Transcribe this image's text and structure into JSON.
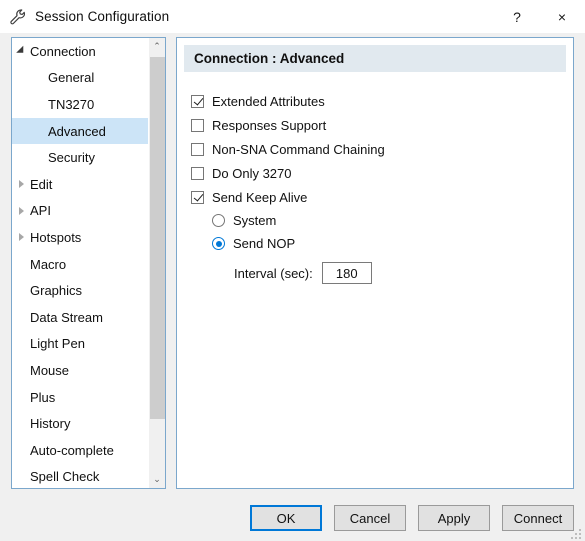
{
  "window": {
    "title": "Session Configuration",
    "icon": "wrench-icon",
    "help_label": "?",
    "close_label": "×"
  },
  "sidebar": {
    "items": [
      {
        "label": "Connection",
        "level": 0,
        "twisty": "expanded",
        "selected": false
      },
      {
        "label": "General",
        "level": 1,
        "twisty": "none",
        "selected": false
      },
      {
        "label": "TN3270",
        "level": 1,
        "twisty": "none",
        "selected": false
      },
      {
        "label": "Advanced",
        "level": 1,
        "twisty": "none",
        "selected": true
      },
      {
        "label": "Security",
        "level": 1,
        "twisty": "none",
        "selected": false
      },
      {
        "label": "Edit",
        "level": 0,
        "twisty": "collapsed",
        "selected": false
      },
      {
        "label": "API",
        "level": 0,
        "twisty": "collapsed",
        "selected": false
      },
      {
        "label": "Hotspots",
        "level": 0,
        "twisty": "collapsed",
        "selected": false
      },
      {
        "label": "Macro",
        "level": 0,
        "twisty": "none",
        "selected": false
      },
      {
        "label": "Graphics",
        "level": 0,
        "twisty": "none",
        "selected": false
      },
      {
        "label": "Data Stream",
        "level": 0,
        "twisty": "none",
        "selected": false
      },
      {
        "label": "Light Pen",
        "level": 0,
        "twisty": "none",
        "selected": false
      },
      {
        "label": "Mouse",
        "level": 0,
        "twisty": "none",
        "selected": false
      },
      {
        "label": "Plus",
        "level": 0,
        "twisty": "none",
        "selected": false
      },
      {
        "label": "History",
        "level": 0,
        "twisty": "none",
        "selected": false
      },
      {
        "label": "Auto-complete",
        "level": 0,
        "twisty": "none",
        "selected": false
      },
      {
        "label": "Spell Check",
        "level": 0,
        "twisty": "none",
        "selected": false
      }
    ],
    "scrollbar": {
      "up_arrow": "⌃",
      "down_arrow": "⌄"
    }
  },
  "content": {
    "header_title": "Connection : Advanced",
    "checkboxes": [
      {
        "label": "Extended Attributes",
        "checked": true
      },
      {
        "label": "Responses Support",
        "checked": false
      },
      {
        "label": "Non-SNA Command Chaining",
        "checked": false
      },
      {
        "label": "Do Only 3270",
        "checked": false
      },
      {
        "label": "Send Keep Alive",
        "checked": true
      }
    ],
    "radios": [
      {
        "label": "System",
        "checked": false
      },
      {
        "label": "Send NOP",
        "checked": true
      }
    ],
    "interval": {
      "label": "Interval (sec):",
      "value": "180"
    }
  },
  "buttons": [
    {
      "label": "OK",
      "default": true
    },
    {
      "label": "Cancel",
      "default": false
    },
    {
      "label": "Apply",
      "default": false
    },
    {
      "label": "Connect",
      "default": false
    }
  ],
  "colors": {
    "accent": "#0078d7",
    "selection": "#cce4f7",
    "header_band": "#e1e9ef",
    "panel_border": "#7ba7cc",
    "dialog_bg": "#f0f0f0"
  }
}
